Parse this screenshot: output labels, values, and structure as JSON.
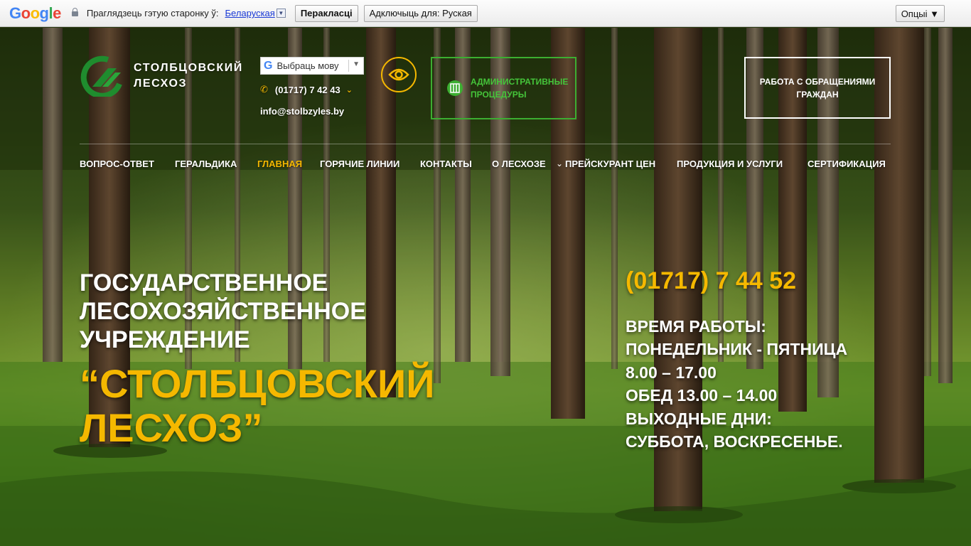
{
  "translate_bar": {
    "logo_text": "Google",
    "question": "Прaглядзець гэтую старонку ў:",
    "language": "Беларуская",
    "translate_button": "Перакласці",
    "disable_button": "Адключыць для: Руская",
    "options_button": "Опцыі ▼"
  },
  "header": {
    "logo_line1": "Столбцовский",
    "logo_line2": "лесхоз",
    "language_selector": "Выбраць мову",
    "phone": "(01717) 7 42 43",
    "email": "info@stolbzyles.by",
    "admin_procedures_line1": "Административные",
    "admin_procedures_line2": "процедуры",
    "appeals": "Работа с обращениями граждан"
  },
  "nav": {
    "items": [
      {
        "label": "Вопрос-ответ"
      },
      {
        "label": "Геральдика"
      },
      {
        "label": "Главная"
      },
      {
        "label": "Горячие линии"
      },
      {
        "label": "Контакты"
      },
      {
        "label": "О лесхозе"
      },
      {
        "label": "Прейскурант цен"
      },
      {
        "label": "Продукция и услуги"
      },
      {
        "label": "Сертификация"
      }
    ],
    "active_index": 2
  },
  "hero": {
    "title_line1": "Государственное",
    "title_line2": "лесохозяйственное",
    "title_line3": "учреждение",
    "name_line1": "“Столбцовский",
    "name_line2": "лесхоз”",
    "phone": "(01717) 7 44 52",
    "hours": [
      "Время работы:",
      "Понедельник - пятница",
      "8.00 – 17.00",
      "Обед 13.00 – 14.00",
      "Выходные дни:",
      "суббота, воскресенье."
    ]
  },
  "colors": {
    "accent_yellow": "#f5b800",
    "accent_green": "#3cae31",
    "nav_active": "#f5b800"
  },
  "icons": [
    "lock-icon",
    "google-g-icon",
    "phone-icon",
    "chevron-down-icon",
    "eye-icon",
    "procedures-icon",
    "logo-icon"
  ]
}
